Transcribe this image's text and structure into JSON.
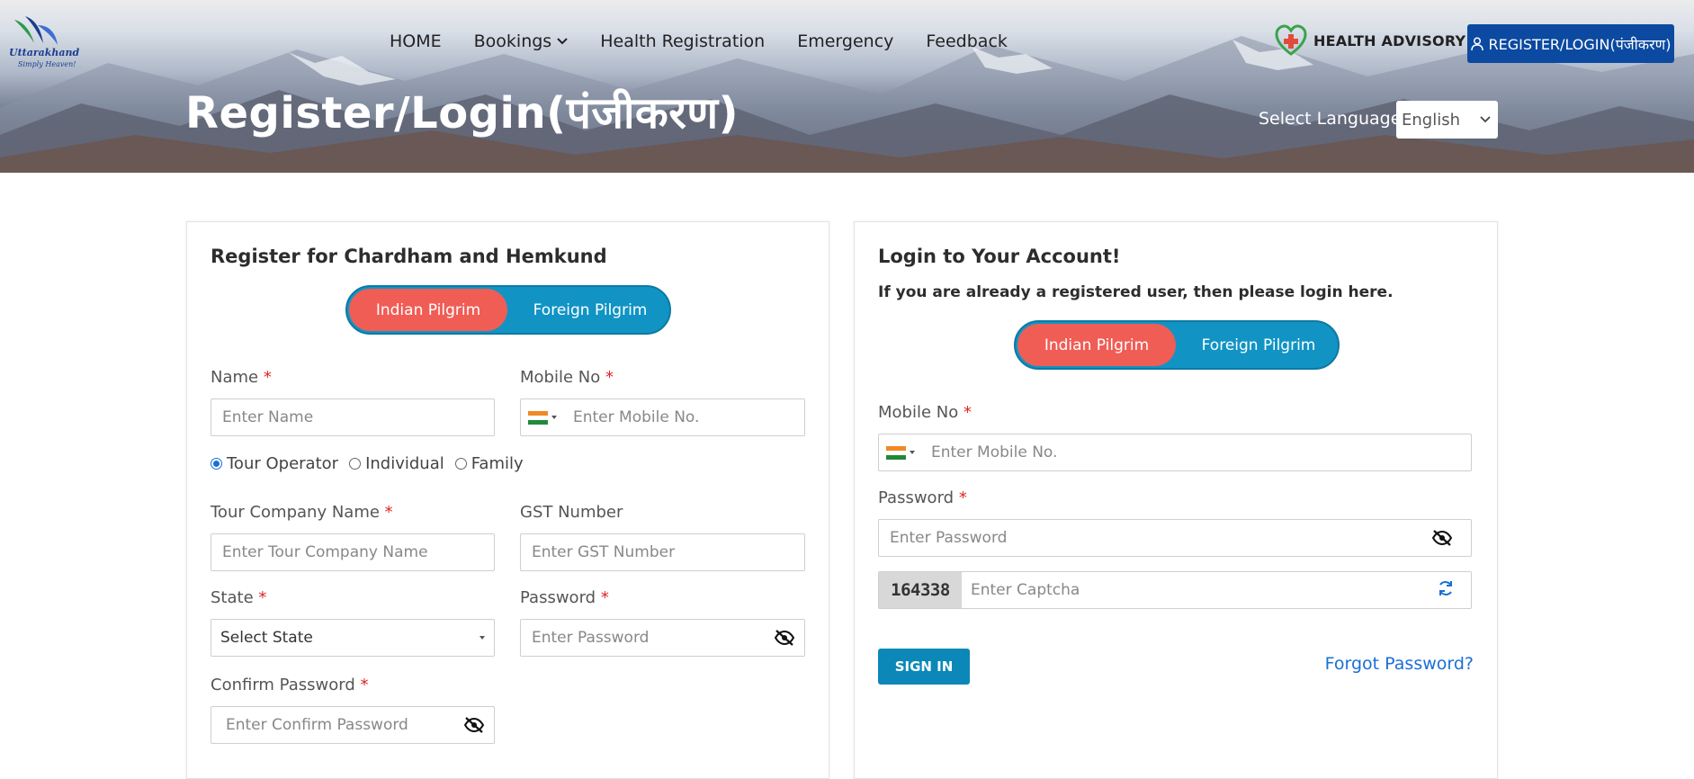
{
  "header": {
    "logo": {
      "brand": "Uttarakhand",
      "tagline": "Simply Heaven!"
    },
    "nav": [
      {
        "label": "HOME"
      },
      {
        "label": "Bookings"
      },
      {
        "label": "Health Registration"
      },
      {
        "label": "Emergency"
      },
      {
        "label": "Feedback"
      }
    ],
    "health_advisory": "HEALTH ADVISORY",
    "register_login_button": "REGISTER/LOGIN(पंजीकरण)",
    "page_title": "Register/Login(पंजीकरण)",
    "language": {
      "label": "Select Language",
      "selected": "English"
    }
  },
  "register": {
    "title": "Register for Chardham and Hemkund",
    "toggle": {
      "indian": "Indian Pilgrim",
      "foreign": "Foreign Pilgrim",
      "active": "Indian Pilgrim"
    },
    "name": {
      "label": "Name",
      "placeholder": "Enter Name"
    },
    "mobile": {
      "label": "Mobile No",
      "placeholder": "Enter  Mobile No."
    },
    "type_options": [
      {
        "label": "Tour Operator",
        "checked": true
      },
      {
        "label": "Individual",
        "checked": false
      },
      {
        "label": "Family",
        "checked": false
      }
    ],
    "company": {
      "label": "Tour Company Name",
      "placeholder": "Enter Tour Company Name"
    },
    "gst": {
      "label": "GST Number",
      "placeholder": "Enter GST Number"
    },
    "state": {
      "label": "State",
      "selected": "Select State"
    },
    "password": {
      "label": "Password",
      "placeholder": "Enter  Password"
    },
    "confirm_password": {
      "label": "Confirm Password",
      "placeholder": "Enter Confirm Password"
    },
    "required_mark": "*"
  },
  "login": {
    "title": "Login to Your Account!",
    "subtitle": "If you are already a registered user, then please login here.",
    "toggle": {
      "indian": "Indian Pilgrim",
      "foreign": "Foreign Pilgrim",
      "active": "Indian Pilgrim"
    },
    "mobile": {
      "label": "Mobile No",
      "placeholder": "Enter  Mobile No."
    },
    "password": {
      "label": "Password",
      "placeholder": "Enter  Password"
    },
    "captcha": {
      "code": "164338",
      "placeholder": "Enter Captcha"
    },
    "sign_in": "SIGN IN",
    "forgot": "Forgot Password?",
    "required_mark": "*"
  },
  "colors": {
    "primary_blue": "#0b4aa0",
    "toggle_blue": "#1194c4",
    "toggle_active": "#f05d55",
    "link_blue": "#1a6fd6",
    "required_red": "#e02424"
  }
}
